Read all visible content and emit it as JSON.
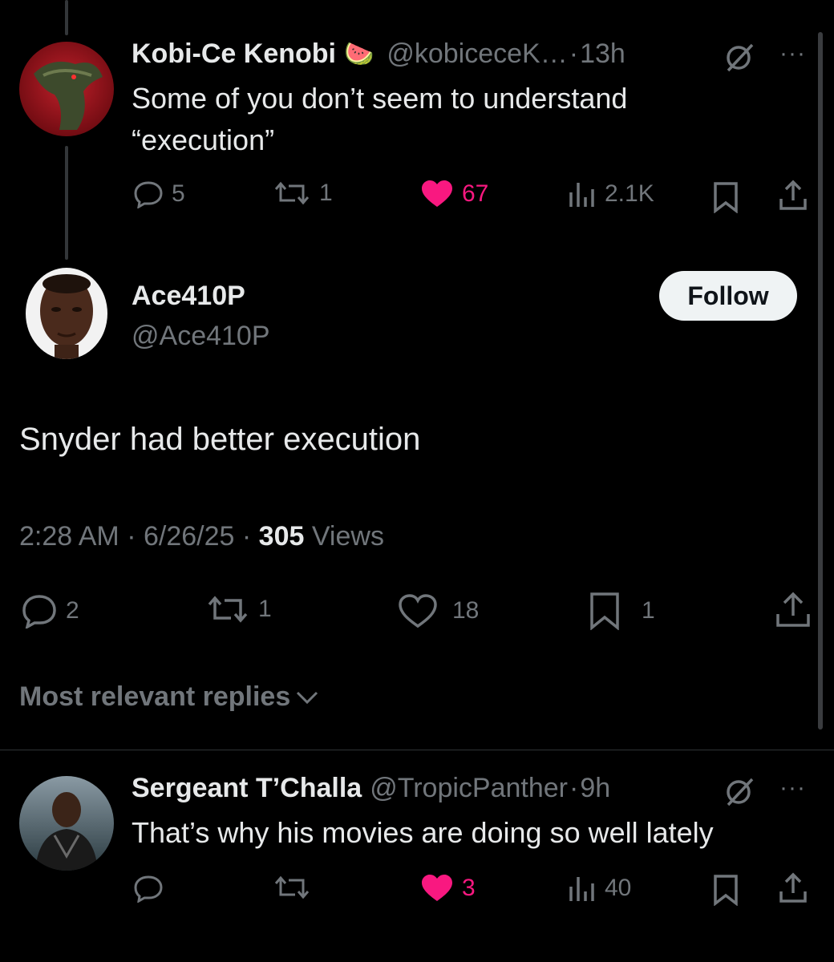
{
  "parent_tweet": {
    "name": "Kobi-Ce Kenobi",
    "emoji": "🍉",
    "handle": "@kobiceceK…",
    "dot": "·",
    "time": "13h",
    "text_line1": "Some of you don’t seem to understand",
    "text_line2": "“execution”",
    "replies": "5",
    "reposts": "1",
    "likes": "67",
    "views": "2.1K",
    "more": "···"
  },
  "main_tweet": {
    "name": "Ace410P",
    "handle": "@Ace410P",
    "follow_label": "Follow",
    "text": "Snyder had better execution",
    "time": "2:28 AM",
    "date": "6/26/25",
    "sep": "·",
    "views_count": "305",
    "views_label": "Views",
    "replies": "2",
    "reposts": "1",
    "likes": "18",
    "bookmarks": "1"
  },
  "replies_section": {
    "sort_label": "Most relevant replies"
  },
  "reply_tweet": {
    "name": "Sergeant T’Challa",
    "handle": "@TropicPanther",
    "dot": "·",
    "time": "9h",
    "text": "That’s why his movies are doing so well lately",
    "likes": "3",
    "views": "40",
    "more": "···"
  },
  "colors": {
    "background": "#000000",
    "text": "#e7e9ea",
    "secondary": "#71767b",
    "like_pink": "#f91880",
    "follow_bg": "#eff3f4"
  },
  "icons": [
    "reply-icon",
    "repost-icon",
    "like-icon",
    "views-icon",
    "bookmark-icon",
    "share-icon",
    "grok-icon",
    "more-icon",
    "chevron-down-icon"
  ]
}
